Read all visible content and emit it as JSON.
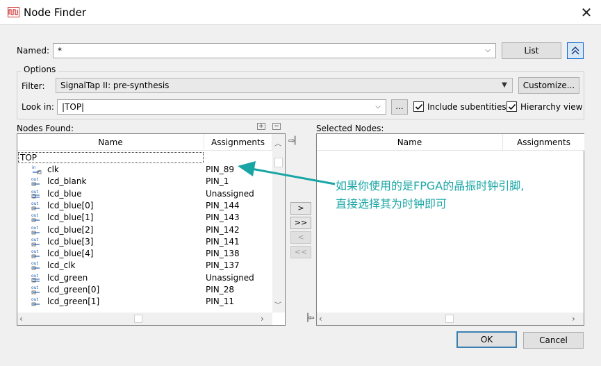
{
  "window": {
    "title": "Node Finder"
  },
  "named": {
    "label": "Named:",
    "value": "*",
    "list_button": "List"
  },
  "options": {
    "title": "Options",
    "filter_label": "Filter:",
    "filter_value": "SignalTap II: pre-synthesis",
    "customize_button": "Customize...",
    "lookin_label": "Look in:",
    "lookin_value": "|TOP|",
    "browse_button": "...",
    "include_subentities": {
      "label": "Include subentities",
      "checked": true
    },
    "hierarchy_view": {
      "label": "Hierarchy view",
      "checked": true
    }
  },
  "nodes_found": {
    "label": "Nodes Found:",
    "columns": [
      "Name",
      "Assignments"
    ],
    "root": "TOP",
    "rows": [
      {
        "icon": "in-pin-icon",
        "name": "clk",
        "assignment": "PIN_89"
      },
      {
        "icon": "out-pin-icon",
        "name": "lcd_blank",
        "assignment": "PIN_1"
      },
      {
        "icon": "out-bus-icon",
        "name": "lcd_blue",
        "assignment": "Unassigned"
      },
      {
        "icon": "out-pin-icon",
        "name": "lcd_blue[0]",
        "assignment": "PIN_144"
      },
      {
        "icon": "out-pin-icon",
        "name": "lcd_blue[1]",
        "assignment": "PIN_143"
      },
      {
        "icon": "out-pin-icon",
        "name": "lcd_blue[2]",
        "assignment": "PIN_142"
      },
      {
        "icon": "out-pin-icon",
        "name": "lcd_blue[3]",
        "assignment": "PIN_141"
      },
      {
        "icon": "out-pin-icon",
        "name": "lcd_blue[4]",
        "assignment": "PIN_138"
      },
      {
        "icon": "out-pin-icon",
        "name": "lcd_clk",
        "assignment": "PIN_137"
      },
      {
        "icon": "out-bus-icon",
        "name": "lcd_green",
        "assignment": "Unassigned"
      },
      {
        "icon": "out-pin-icon",
        "name": "lcd_green[0]",
        "assignment": "PIN_28"
      },
      {
        "icon": "out-pin-icon",
        "name": "lcd_green[1]",
        "assignment": "PIN_11"
      }
    ]
  },
  "transfer": {
    "add": ">",
    "add_all": ">>",
    "remove": "<",
    "remove_all": "<<"
  },
  "selected_nodes": {
    "label": "Selected Nodes:",
    "columns": [
      "Name",
      "Assignments"
    ]
  },
  "buttons": {
    "ok": "OK",
    "cancel": "Cancel"
  },
  "annotation": {
    "line1": "如果你使用的是FPGA的晶振时钟引脚,",
    "line2": "直接选择其为时钟即可",
    "color": "#1aa5a5"
  }
}
